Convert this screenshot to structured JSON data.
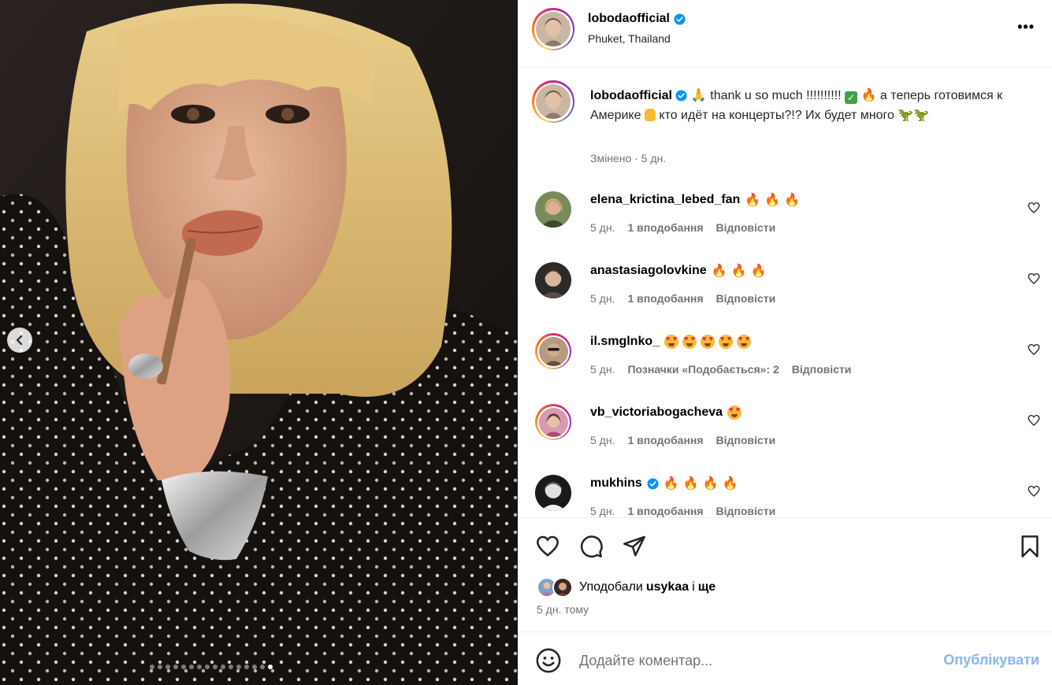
{
  "post": {
    "author": "lobodaofficial",
    "location": "Phuket, Thailand",
    "more": "•••"
  },
  "caption": {
    "username": "lobodaofficial",
    "part1": " 🙏 thank u so much !!!!!!!!!! ",
    "part2": " 🔥 а теперь готовимся к Америке ",
    "part3": " кто идёт на концерты?!? Их будет много ",
    "part4": "🦖🦖",
    "meta": "Змінено · 5 дн."
  },
  "comments": [
    {
      "username": "elena_krictina_lebed_fan",
      "text": "🔥 🔥 🔥",
      "time": "5 дн.",
      "likes": "1 вподобання",
      "reply": "Відповісти"
    },
    {
      "username": "anastasiagolovkine",
      "text": "🔥 🔥 🔥",
      "time": "5 дн.",
      "likes": "1 вподобання",
      "reply": "Відповісти"
    },
    {
      "username": "il.smglnko_",
      "text": "",
      "time": "5 дн.",
      "likes": "Позначки «Подобається»: 2",
      "reply": "Відповісти"
    },
    {
      "username": "vb_victoriabogacheva",
      "text": "",
      "time": "5 дн.",
      "likes": "1 вподобання",
      "reply": "Відповісти"
    },
    {
      "username": "mukhins",
      "text": "🔥 🔥 🔥 🔥",
      "time": "5 дн.",
      "likes": "1 вподобання",
      "reply": "Відповісти"
    }
  ],
  "likes": {
    "prefix": "Уподобали",
    "user": "usykaa",
    "joiner": "і",
    "more": "ще"
  },
  "time_ago": "5 дн. тому",
  "add_comment": {
    "placeholder": "Додайте коментар...",
    "publish": "Опублікувати"
  },
  "carousel": {
    "total": 16,
    "active_index": 15
  },
  "colors": {
    "verified": "#0095f6",
    "publish": "#85b8f2",
    "secondary_text": "#737373"
  }
}
